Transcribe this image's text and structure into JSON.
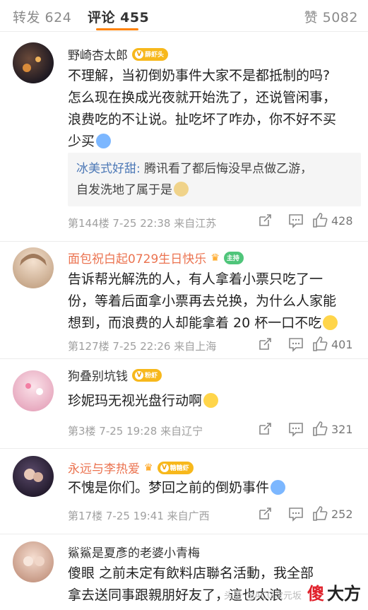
{
  "tabs": {
    "repost": "转发 624",
    "comments": "评论 455",
    "likes": "赞 5082"
  },
  "comments": [
    {
      "username": "野崎杏太郎",
      "badge": "薛虾头",
      "text_lines": [
        "不理解，当初倒奶事件大家不是都抵制的吗?",
        "怎么现在换成光夜就开始洗了，还说管闲事，",
        "浪费吃的不让说。扯吃坏了咋办，你不好不买",
        "少买"
      ],
      "reply_name": "冰美式好甜:",
      "reply_text_1": " 腾讯看了都后悔没早点做乙游，",
      "reply_text_2": "自发洗地了属于是",
      "meta": "第144楼  7-25 22:38  来自江苏",
      "likes": "428"
    },
    {
      "username": "面包祝白起0729生日快乐",
      "badge": "主持",
      "text_lines": [
        "告诉帮光解洗的人，有人拿着小票只吃了一",
        "份，等着后面拿小票再去兑换，为什么人家能",
        "想到，而浪费的人却能拿着 20 杯一口不吃"
      ],
      "meta": "第127楼  7-25 22:26  来自上海",
      "likes": "401"
    },
    {
      "username": "狗叠别坑钱",
      "badge": "粉虾",
      "text_lines": [
        "珍妮玛无视光盘行动啊"
      ],
      "meta": "第3楼  7-25 19:28  来自辽宁",
      "likes": "321"
    },
    {
      "username": "永远与李热爱",
      "badge": "糖糖虾",
      "text_lines": [
        "不愧是你们。梦回之前的倒奶事件"
      ],
      "meta": "第17楼  7-25 19:41  来自广西",
      "likes": "252"
    },
    {
      "username": "鯊鯊是夏彥的老婆小青梅",
      "text_lines": [
        "傻眼  之前未定有飲料店聯名活動，我全部",
        "拿去送同事跟親朋好友了，這也太浪"
      ]
    }
  ],
  "watermark": {
    "small": "头条 @ACG次元坂",
    "big1": "傻",
    "big2": "大方"
  },
  "colors": {
    "accent": "#ff8200",
    "vip_name": "#eb7350",
    "reply_name": "#4c78b6"
  }
}
